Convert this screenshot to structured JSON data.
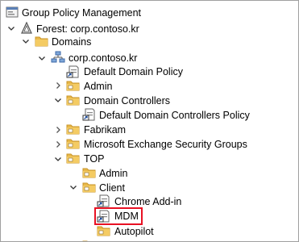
{
  "tree": {
    "root": "Group Policy Management",
    "forest": "Forest: corp.contoso.kr",
    "domains": "Domains",
    "domain": "corp.contoso.kr",
    "default_domain_policy": "Default Domain Policy",
    "admin": "Admin",
    "domain_controllers": "Domain Controllers",
    "default_dc_policy": "Default Domain Controllers Policy",
    "fabrikam": "Fabrikam",
    "exchange": "Microsoft Exchange Security Groups",
    "top": "TOP",
    "top_admin": "Admin",
    "client": "Client",
    "chrome": "Chrome Add-in",
    "mdm": "MDM",
    "autopilot": "Autopilot"
  },
  "colors": {
    "folder": "#e8b84a",
    "folder_dark": "#c9962a",
    "selection_border": "#e81123"
  }
}
